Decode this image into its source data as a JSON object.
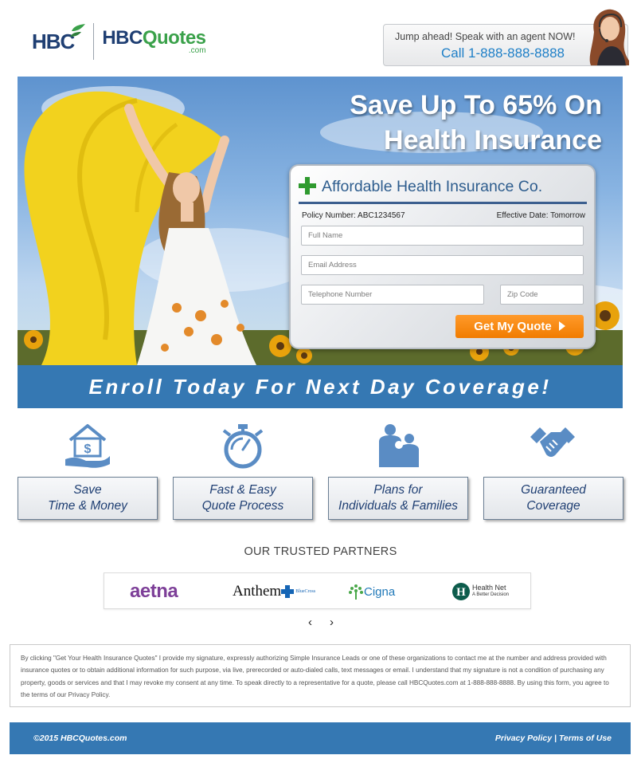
{
  "header": {
    "logo_mark": "HBC",
    "brand_part1": "HBC",
    "brand_part2": "Quotes",
    "brand_suffix": ".com",
    "agent_prompt": "Jump ahead! Speak with an agent NOW!",
    "agent_phone": "Call 1-888-888-8888"
  },
  "hero": {
    "title_line1": "Save Up To 65% On",
    "title_line2": "Health Insurance"
  },
  "form": {
    "title": "Affordable Health Insurance Co.",
    "policy_number": "Policy Number: ABC1234567",
    "effective_date": "Effective Date: Tomorrow",
    "full_name_placeholder": "Full Name",
    "email_placeholder": "Email Address",
    "phone_placeholder": "Telephone Number",
    "zip_placeholder": "Zip Code",
    "submit_label": "Get My Quote"
  },
  "enroll_banner": "Enroll Today For Next Day Coverage!",
  "features": [
    {
      "line1": "Save",
      "line2": "Time & Money",
      "icon": "house-money-icon"
    },
    {
      "line1": "Fast & Easy",
      "line2": "Quote Process",
      "icon": "stopwatch-icon"
    },
    {
      "line1": "Plans for",
      "line2": "Individuals & Families",
      "icon": "family-icon"
    },
    {
      "line1": "Guaranteed",
      "line2": "Coverage",
      "icon": "handshake-icon"
    }
  ],
  "partners": {
    "title": "OUR TRUSTED PARTNERS",
    "logos": [
      "aetna",
      "Anthem",
      "Cigna",
      "Health Net"
    ],
    "anthem_sub": "BlueCross",
    "healthnet_tagline": "A Better Decision",
    "prev_arrow": "‹",
    "next_arrow": "›"
  },
  "disclaimer": "By clicking \"Get Your Health Insurance Quotes\" I provide my signature, expressly authorizing Simple Insurance Leads or one of these organizations to contact me at the number and address provided with insurance quotes or to obtain additional information for such purpose, via live, prerecorded or auto-dialed calls, text messages or email. I understand that my signature is not a condition of purchasing any property, goods or services and that I may revoke my consent at any time. To speak directly to a representative for a quote, please call HBCQuotes.com at 1-888-888-8888. By using this form, you agree to the terms of our Privacy Policy.",
  "footer": {
    "copyright": "©2015 HBCQuotes.com",
    "privacy_label": "Privacy Policy",
    "separator": " | ",
    "terms_label": "Terms of Use"
  },
  "colors": {
    "brand_blue": "#1f3f73",
    "brand_green": "#3aa14a",
    "bar_blue": "#3578b3",
    "cta_orange": "#f17c00",
    "icon_blue": "#5a8cc4"
  }
}
